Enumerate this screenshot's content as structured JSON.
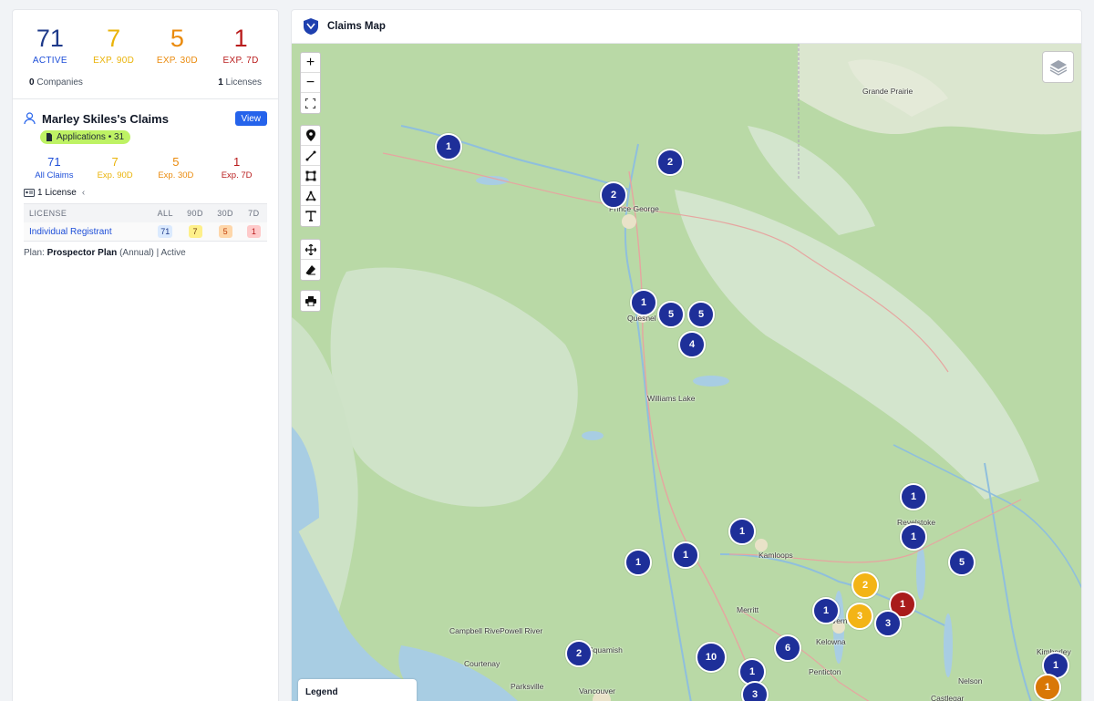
{
  "summary": {
    "active": {
      "value": "71",
      "label": "ACTIVE"
    },
    "exp90": {
      "value": "7",
      "label": "EXP. 90D"
    },
    "exp30": {
      "value": "5",
      "label": "EXP. 30D"
    },
    "exp7": {
      "value": "1",
      "label": "EXP. 7D"
    },
    "companies_count": "0",
    "companies_label": "Companies",
    "licenses_count": "1",
    "licenses_label": "Licenses"
  },
  "claims": {
    "title": "Marley Skiles's Claims",
    "view_label": "View",
    "badge": "Applications • 31",
    "stats": [
      {
        "value": "71",
        "label": "All Claims"
      },
      {
        "value": "7",
        "label": "Exp. 90D"
      },
      {
        "value": "5",
        "label": "Exp. 30D"
      },
      {
        "value": "1",
        "label": "Exp. 7D"
      }
    ],
    "license_toggle": "1 License",
    "table": {
      "headers": [
        "LICENSE",
        "ALL",
        "90D",
        "30D",
        "7D"
      ],
      "row": {
        "name": "Individual Registrant",
        "all": "71",
        "d90": "7",
        "d30": "5",
        "d7": "1"
      }
    },
    "plan": {
      "prefix": "Plan:",
      "name": "Prospector Plan",
      "term": "(Annual)",
      "separator": "|",
      "status": "Active"
    }
  },
  "map": {
    "title": "Claims Map",
    "legend_title": "Legend",
    "colors": {
      "active": "#1e2f99",
      "exp90": "#f3b416",
      "exp7": "#a91b1b",
      "exp30": "#d97706"
    },
    "places": [
      "Grande Prairie",
      "Prince George",
      "Quesnel",
      "Williams Lake",
      "Revelstoke",
      "Kamloops",
      "Merritt",
      "Vernon",
      "Kelowna",
      "Penticton",
      "Nelson",
      "Castlegar",
      "Kimberley",
      "Campbell River",
      "Powell River",
      "Courtenay",
      "Parksville",
      "Squamish",
      "Vancouver"
    ],
    "clusters": [
      "1",
      "2",
      "2",
      "1",
      "5",
      "5",
      "4",
      "1",
      "1",
      "1",
      "1",
      "1",
      "5",
      "2",
      "3",
      "1",
      "1",
      "3",
      "2",
      "10",
      "6",
      "1",
      "3",
      "1",
      "1"
    ]
  }
}
